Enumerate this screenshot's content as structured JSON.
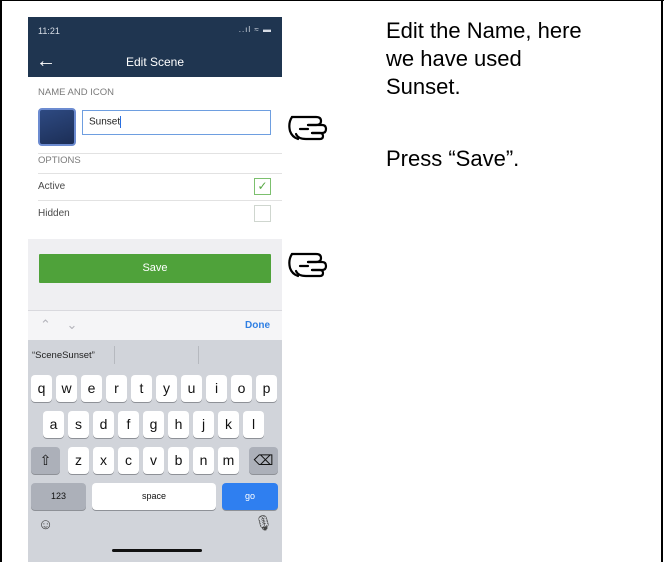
{
  "status_bar": {
    "time": "11:21",
    "indicators": "..ıl ≈ ▬"
  },
  "nav": {
    "back_icon": "arrow-left-icon",
    "title": "Edit Scene"
  },
  "name_section": {
    "header": "NAME AND ICON",
    "name_value": "Sunset"
  },
  "options_section": {
    "header": "OPTIONS",
    "items": [
      {
        "label": "Active",
        "checked": true,
        "check_mark": "✓"
      },
      {
        "label": "Hidden",
        "checked": false
      }
    ]
  },
  "save_button": "Save",
  "keyboard_toolbar": {
    "arrows": "⌃ ⌄",
    "done": "Done"
  },
  "keyboard": {
    "suggestion": "“SceneSunset”",
    "row1": [
      "q",
      "w",
      "e",
      "r",
      "t",
      "y",
      "u",
      "i",
      "o",
      "p"
    ],
    "row2": [
      "a",
      "s",
      "d",
      "f",
      "g",
      "h",
      "j",
      "k",
      "l"
    ],
    "row3": [
      "z",
      "x",
      "c",
      "v",
      "b",
      "n",
      "m"
    ],
    "shift": "⇧",
    "delete": "⌫",
    "numbers": "123",
    "space": "space",
    "go": "go",
    "emoji": "☺",
    "mic": "🎙"
  },
  "instructions": {
    "line1": "Edit the Name, here",
    "line2": "we have used",
    "line3": "Sunset.",
    "line4": "Press “Save”."
  },
  "colors": {
    "nav_bg": "#1f3550",
    "save_green": "#4fa23a",
    "go_blue": "#2f7ff0",
    "done_blue": "#2f7fe3"
  }
}
